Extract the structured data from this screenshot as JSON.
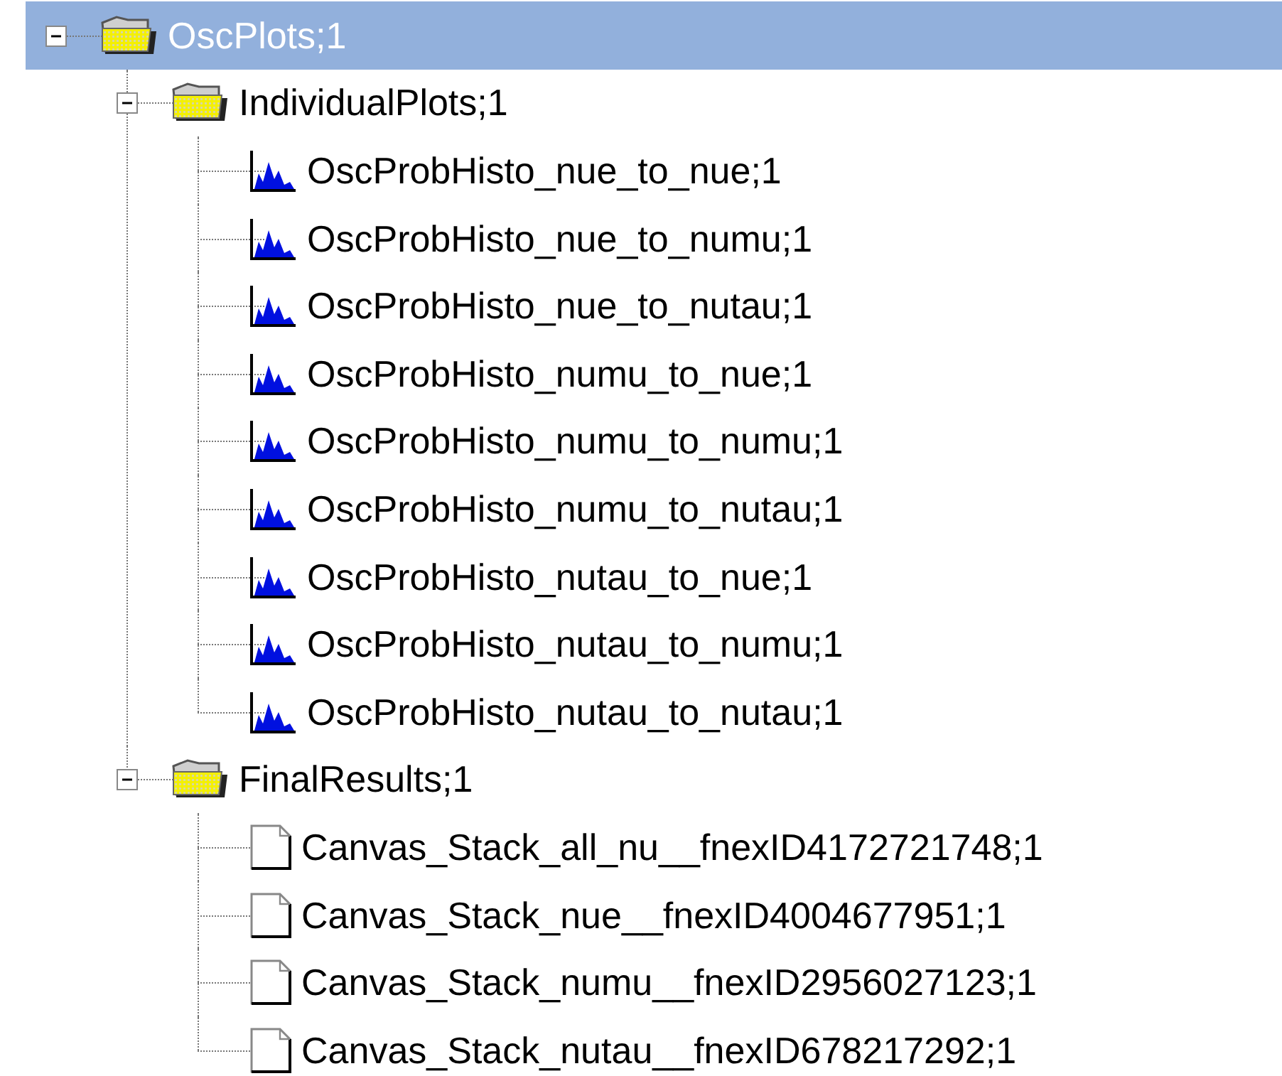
{
  "tree": [
    {
      "kind": "folder",
      "label": "OscPlots;1",
      "selected": true,
      "expanded": true,
      "children": [
        {
          "kind": "folder",
          "label": "IndividualPlots;1",
          "selected": false,
          "expanded": true,
          "children": [
            {
              "kind": "histogram",
              "label": "OscProbHisto_nue_to_nue;1",
              "selected": false
            },
            {
              "kind": "histogram",
              "label": "OscProbHisto_nue_to_numu;1",
              "selected": false
            },
            {
              "kind": "histogram",
              "label": "OscProbHisto_nue_to_nutau;1",
              "selected": false
            },
            {
              "kind": "histogram",
              "label": "OscProbHisto_numu_to_nue;1",
              "selected": false
            },
            {
              "kind": "histogram",
              "label": "OscProbHisto_numu_to_numu;1",
              "selected": false
            },
            {
              "kind": "histogram",
              "label": "OscProbHisto_numu_to_nutau;1",
              "selected": false
            },
            {
              "kind": "histogram",
              "label": "OscProbHisto_nutau_to_nue;1",
              "selected": false
            },
            {
              "kind": "histogram",
              "label": "OscProbHisto_nutau_to_numu;1",
              "selected": false
            },
            {
              "kind": "histogram",
              "label": "OscProbHisto_nutau_to_nutau;1",
              "selected": false
            }
          ]
        },
        {
          "kind": "folder",
          "label": "FinalResults;1",
          "selected": false,
          "expanded": true,
          "children": [
            {
              "kind": "canvas",
              "label": "Canvas_Stack_all_nu__fnexID4172721748;1",
              "selected": false
            },
            {
              "kind": "canvas",
              "label": "Canvas_Stack_nue__fnexID4004677951;1",
              "selected": false
            },
            {
              "kind": "canvas",
              "label": "Canvas_Stack_numu__fnexID2956027123;1",
              "selected": false
            },
            {
              "kind": "canvas",
              "label": "Canvas_Stack_nutau__fnexID678217292;1",
              "selected": false
            }
          ]
        }
      ]
    }
  ]
}
